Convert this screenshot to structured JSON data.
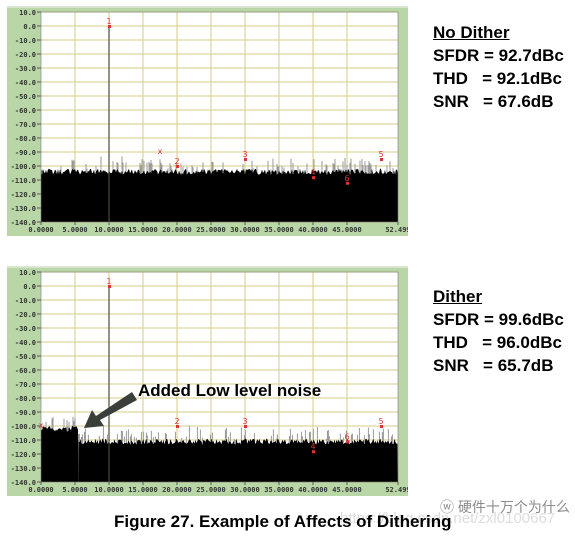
{
  "figure_caption": "Figure 27. Example of Affects of Dithering",
  "annotation": "Added Low level noise",
  "watermark": "硬件十万个为什么",
  "watermark_url": "https://blog.csdn.net/zxl0100667",
  "colors": {
    "frame": "#b9d6a6",
    "grid": "#d6cd8a",
    "noise": "#000000",
    "noise_tips": "#9a9a9a",
    "marker": "#e03030",
    "arrow": "#3a3f3a"
  },
  "chart_data": [
    {
      "type": "line",
      "title": "No Dither",
      "xlabel": "",
      "ylabel": "",
      "xlim": [
        0,
        52.499
      ],
      "ylim": [
        -140,
        10
      ],
      "grid": true,
      "x_ticks": [
        "0.0000",
        "5.0000",
        "10.0000",
        "15.0000",
        "20.0000",
        "25.0000",
        "30.0000",
        "35.0000",
        "40.0000",
        "45.0000",
        "52.499"
      ],
      "x_tick_values": [
        0,
        5,
        10,
        15,
        20,
        25,
        30,
        35,
        40,
        45,
        52.499
      ],
      "y_ticks": [
        "10.0",
        "0.0",
        "-10.0",
        "-20.0",
        "-30.0",
        "-40.0",
        "-50.0",
        "-60.0",
        "-70.0",
        "-80.0",
        "-90.0",
        "-100.0",
        "-110.0",
        "-120.0",
        "-130.0",
        "-140.0"
      ],
      "y_tick_values": [
        10,
        0,
        -10,
        -20,
        -30,
        -40,
        -50,
        -60,
        -70,
        -80,
        -90,
        -100,
        -110,
        -120,
        -130,
        -140
      ],
      "noise_floor": [
        {
          "from": 0,
          "to": 52.499,
          "level": -104
        }
      ],
      "fundamental": {
        "x": 10,
        "y": 0
      },
      "markers": [
        {
          "label": "1",
          "x": 10,
          "y": 0
        },
        {
          "label": "x",
          "x": 17.5,
          "y": -90
        },
        {
          "label": "2",
          "x": 20,
          "y": -100
        },
        {
          "label": "3",
          "x": 30,
          "y": -95
        },
        {
          "label": "4",
          "x": 40,
          "y": -108
        },
        {
          "label": "6",
          "x": 45,
          "y": -112
        },
        {
          "label": "5",
          "x": 50,
          "y": -95
        }
      ],
      "stats": {
        "SFDR": "92.7dBc",
        "THD": "92.1dBc",
        "SNR": "67.6dB"
      }
    },
    {
      "type": "line",
      "title": "Dither",
      "xlabel": "",
      "ylabel": "",
      "xlim": [
        0,
        52.499
      ],
      "ylim": [
        -140,
        10
      ],
      "grid": true,
      "x_ticks": [
        "0.0000",
        "5.0000",
        "10.0000",
        "15.0000",
        "20.0000",
        "25.0000",
        "30.0000",
        "35.0000",
        "40.0000",
        "45.0000",
        "52.499"
      ],
      "x_tick_values": [
        0,
        5,
        10,
        15,
        20,
        25,
        30,
        35,
        40,
        45,
        52.499
      ],
      "y_ticks": [
        "10.0",
        "0.0",
        "-10.0",
        "-20.0",
        "-30.0",
        "-40.0",
        "-50.0",
        "-60.0",
        "-70.0",
        "-80.0",
        "-90.0",
        "-100.0",
        "-110.0",
        "-120.0",
        "-130.0",
        "-140.0"
      ],
      "y_tick_values": [
        10,
        0,
        -10,
        -20,
        -30,
        -40,
        -50,
        -60,
        -70,
        -80,
        -90,
        -100,
        -110,
        -120,
        -130,
        -140
      ],
      "noise_floor": [
        {
          "from": 0,
          "to": 5.5,
          "level": -102
        },
        {
          "from": 5.5,
          "to": 52.499,
          "level": -111
        }
      ],
      "fundamental": {
        "x": 10,
        "y": 0
      },
      "markers": [
        {
          "label": "x",
          "x": 0,
          "y": -100
        },
        {
          "label": "1",
          "x": 10,
          "y": 0
        },
        {
          "label": "2",
          "x": 20,
          "y": -100
        },
        {
          "label": "3",
          "x": 30,
          "y": -100
        },
        {
          "label": "4",
          "x": 40,
          "y": -118
        },
        {
          "label": "6",
          "x": 45,
          "y": -111
        },
        {
          "label": "5",
          "x": 50,
          "y": -100
        }
      ],
      "stats": {
        "SFDR": "99.6dBc",
        "THD": "96.0dBc",
        "SNR": "65.7dB"
      }
    }
  ]
}
